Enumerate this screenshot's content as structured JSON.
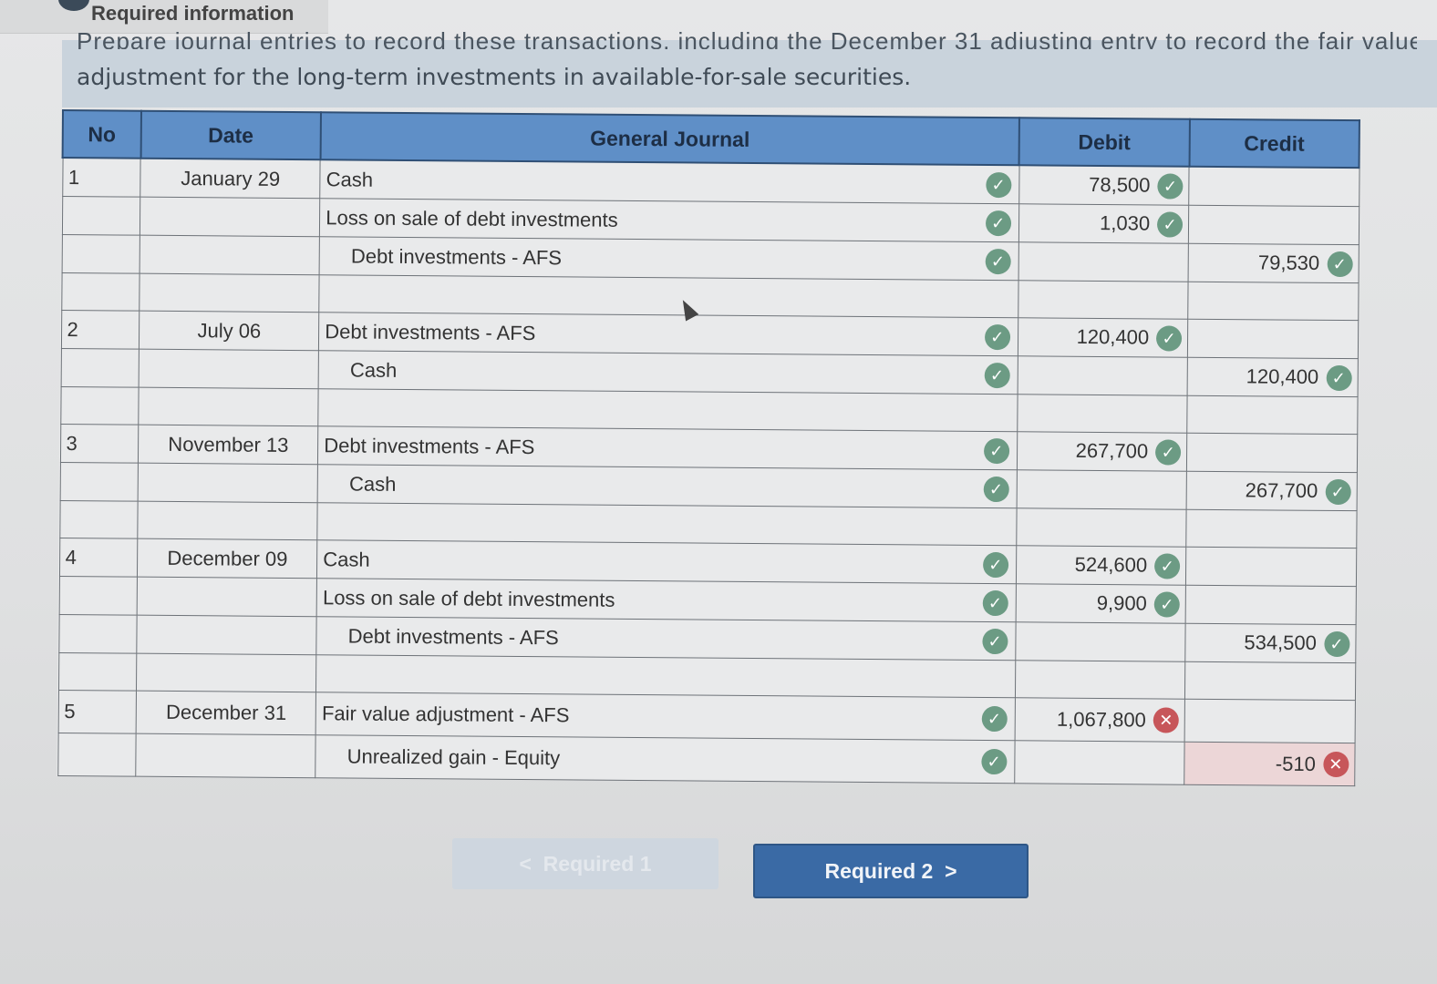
{
  "header": {
    "title": "Required information"
  },
  "instruction": {
    "line1": "Prepare journal entries to record these transactions, including the December 31 adjusting entry to record the fair value",
    "line2": "adjustment for the long-term investments in available-for-sale securities."
  },
  "table": {
    "headers": {
      "no": "No",
      "date": "Date",
      "journal": "General Journal",
      "debit": "Debit",
      "credit": "Credit"
    },
    "rows": [
      {
        "no": "1",
        "date": "January 29",
        "account": "Cash",
        "indent": false,
        "debit": "78,500",
        "credit": "",
        "acct_ok": true,
        "debit_ok": true
      },
      {
        "no": "",
        "date": "",
        "account": "Loss on sale of debt investments",
        "indent": false,
        "debit": "1,030",
        "credit": "",
        "acct_ok": true,
        "debit_ok": true
      },
      {
        "no": "",
        "date": "",
        "account": "Debt investments - AFS",
        "indent": true,
        "debit": "",
        "credit": "79,530",
        "acct_ok": true,
        "credit_ok": true
      },
      {
        "blank": true
      },
      {
        "no": "2",
        "date": "July 06",
        "account": "Debt investments - AFS",
        "indent": false,
        "debit": "120,400",
        "credit": "",
        "acct_ok": true,
        "debit_ok": true
      },
      {
        "no": "",
        "date": "",
        "account": "Cash",
        "indent": true,
        "debit": "",
        "credit": "120,400",
        "acct_ok": true,
        "credit_ok": true
      },
      {
        "blank": true
      },
      {
        "no": "3",
        "date": "November 13",
        "account": "Debt investments - AFS",
        "indent": false,
        "debit": "267,700",
        "credit": "",
        "acct_ok": true,
        "debit_ok": true
      },
      {
        "no": "",
        "date": "",
        "account": "Cash",
        "indent": true,
        "debit": "",
        "credit": "267,700",
        "acct_ok": true,
        "credit_ok": true
      },
      {
        "blank": true
      },
      {
        "no": "4",
        "date": "December 09",
        "account": "Cash",
        "indent": false,
        "debit": "524,600",
        "credit": "",
        "acct_ok": true,
        "debit_ok": true
      },
      {
        "no": "",
        "date": "",
        "account": "Loss on sale of debt investments",
        "indent": false,
        "debit": "9,900",
        "credit": "",
        "acct_ok": true,
        "debit_ok": true
      },
      {
        "no": "",
        "date": "",
        "account": "Debt investments - AFS",
        "indent": true,
        "debit": "",
        "credit": "534,500",
        "acct_ok": true,
        "credit_ok": true
      },
      {
        "blank": true
      },
      {
        "no": "5",
        "date": "December 31",
        "account": "Fair value adjustment - AFS",
        "indent": false,
        "debit": "1,067,800",
        "credit": "",
        "acct_ok": true,
        "debit_ok": false
      },
      {
        "no": "",
        "date": "",
        "account": "Unrealized gain - Equity",
        "indent": true,
        "debit": "",
        "credit": "-510",
        "acct_ok": true,
        "credit_ok": false
      }
    ]
  },
  "nav": {
    "prev_label": "Required 1",
    "next_label": "Required 2"
  },
  "icons": {
    "check": "check-icon",
    "error": "error-icon"
  },
  "colors": {
    "header_blue": "#5f8fc7",
    "check_green": "#6c9b84",
    "error_red": "#c7565a",
    "button_blue": "#3a6aa5"
  }
}
